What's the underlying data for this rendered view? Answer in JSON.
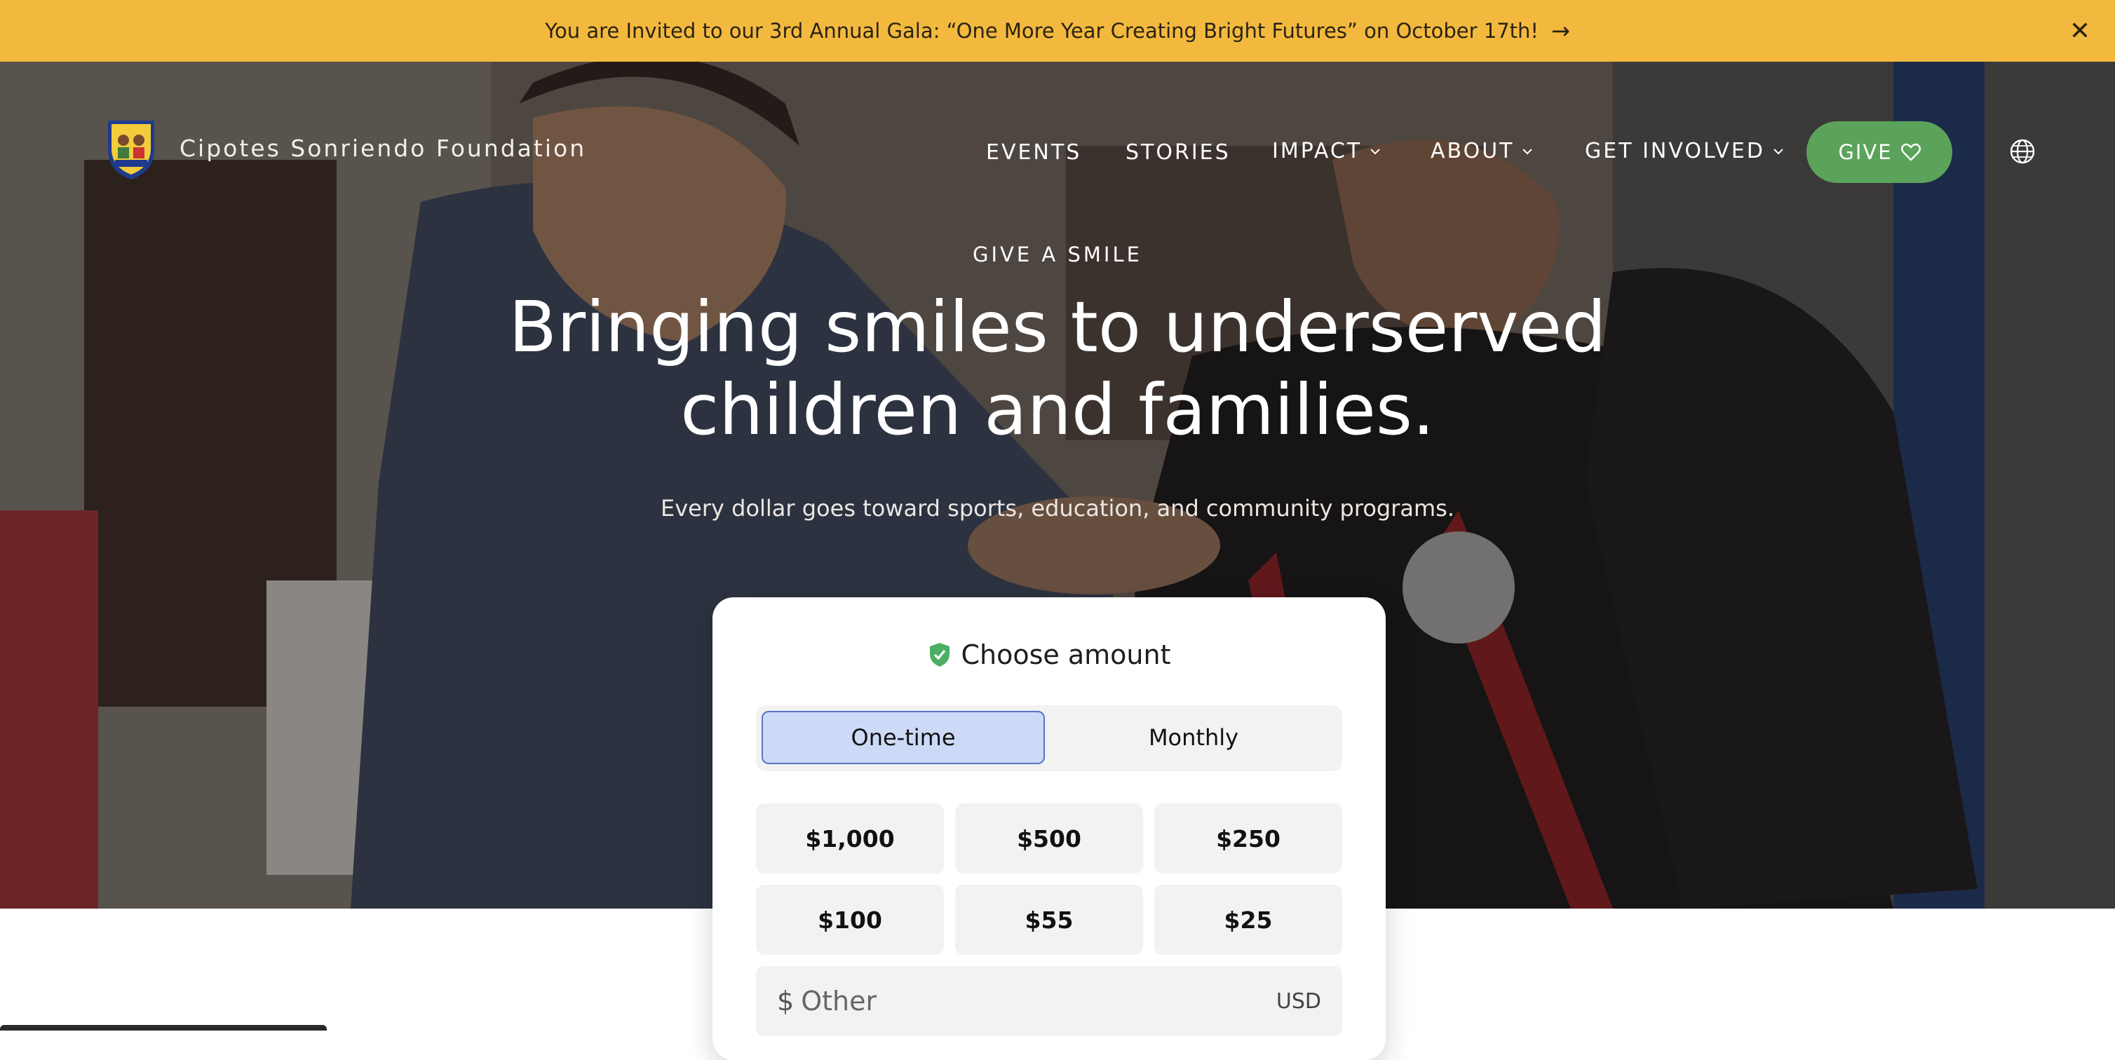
{
  "announcement": {
    "text": "You are Invited to our 3rd Annual Gala: “One More Year Creating Bright Futures” on October 17th!",
    "arrow": "→",
    "close_icon": "close-icon",
    "background": "#f3b93f"
  },
  "nav": {
    "brand": "Cipotes Sonriendo Foundation",
    "items": [
      {
        "label": "EVENTS",
        "has_dropdown": false
      },
      {
        "label": "STORIES",
        "has_dropdown": false
      },
      {
        "label": "IMPACT",
        "has_dropdown": true
      },
      {
        "label": "ABOUT",
        "has_dropdown": true
      },
      {
        "label": "GET INVOLVED",
        "has_dropdown": true
      }
    ],
    "give_label": "GIVE",
    "give_color": "#5ba35a",
    "language_icon": "globe-icon"
  },
  "hero": {
    "eyebrow": "GIVE A SMILE",
    "headline_line1": "Bringing smiles to underserved",
    "headline_line2": "children and families.",
    "subhead": "Every dollar goes toward sports, education, and community programs."
  },
  "donation": {
    "title": "Choose amount",
    "title_icon": "shield-check-icon",
    "frequency": {
      "options": [
        "One-time",
        "Monthly"
      ],
      "selected": "One-time"
    },
    "amounts": [
      "$1,000",
      "$500",
      "$250",
      "$100",
      "$55",
      "$25"
    ],
    "other": {
      "currency_symbol": "$",
      "placeholder": "Other",
      "unit": "USD"
    },
    "accent": "#5a73c6"
  }
}
